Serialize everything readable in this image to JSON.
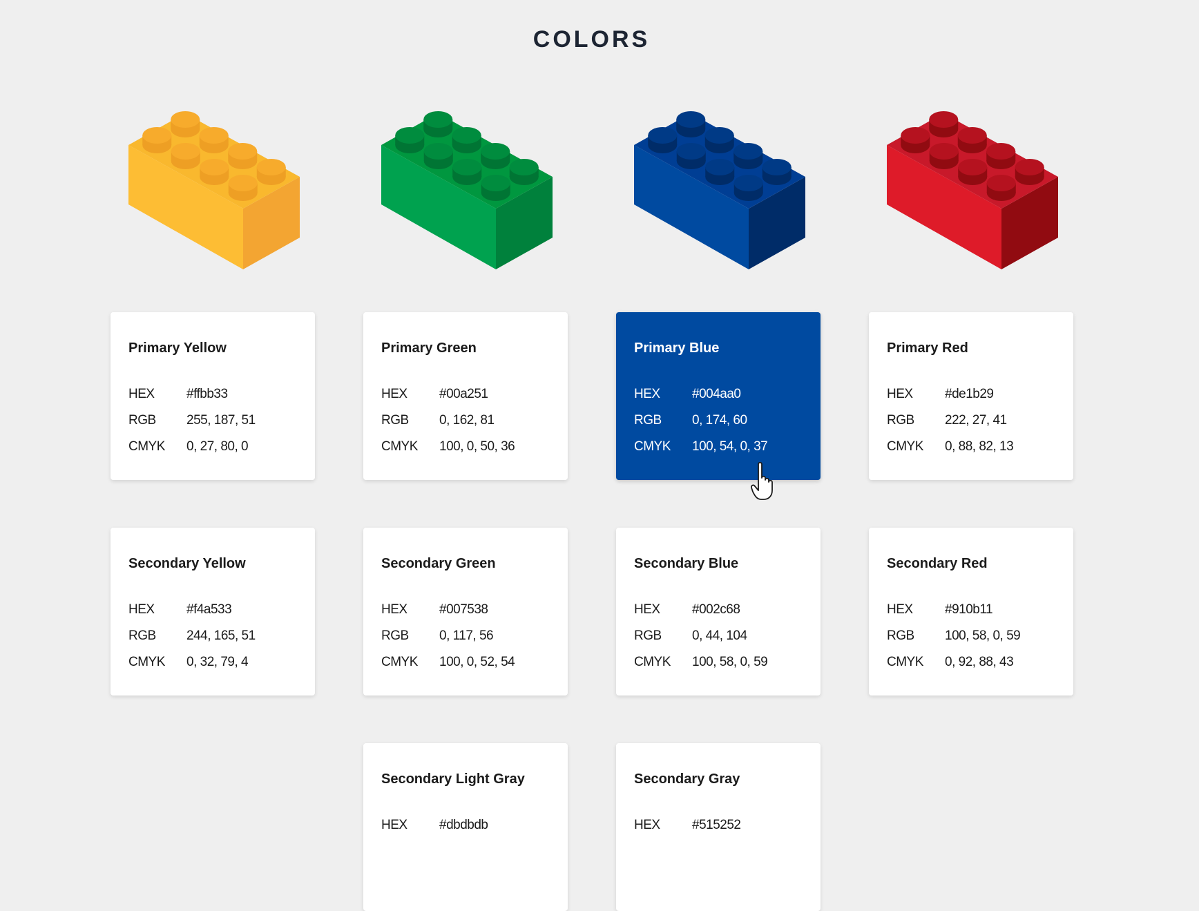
{
  "page": {
    "title": "COLORS"
  },
  "bricks": [
    {
      "name": "yellow-brick",
      "top": "#f9b82e",
      "left": "#fdbd34",
      "right": "#f3a532",
      "stud": "#f7ab2c",
      "stud_side": "#ee9f24"
    },
    {
      "name": "green-brick",
      "top": "#00973f",
      "left": "#00a24f",
      "right": "#00813c",
      "stud": "#008c3e",
      "stud_side": "#007534"
    },
    {
      "name": "blue-brick",
      "top": "#003e94",
      "left": "#004aa0",
      "right": "#002c68",
      "stud": "#003a86",
      "stud_side": "#002c68"
    },
    {
      "name": "red-brick",
      "top": "#c8192a",
      "left": "#de1b29",
      "right": "#910b11",
      "stud": "#b5121f",
      "stud_side": "#910b11"
    }
  ],
  "labels": {
    "hex": "HEX",
    "rgb": "RGB",
    "cmyk": "CMYK"
  },
  "cards": [
    {
      "name": "Primary Yellow",
      "hex": "#ffbb33",
      "rgb": "255, 187, 51",
      "cmyk": "0, 27, 80, 0"
    },
    {
      "name": "Primary Green",
      "hex": "#00a251",
      "rgb": "0, 162, 81",
      "cmyk": "100, 0, 50, 36"
    },
    {
      "name": "Primary Blue",
      "hex": "#004aa0",
      "rgb": "0, 174, 60",
      "cmyk": "100, 54, 0, 37",
      "active": true
    },
    {
      "name": "Primary Red",
      "hex": "#de1b29",
      "rgb": "222, 27, 41",
      "cmyk": "0, 88, 82, 13"
    },
    {
      "name": "Secondary Yellow",
      "hex": "#f4a533",
      "rgb": "244, 165, 51",
      "cmyk": "0, 32, 79, 4"
    },
    {
      "name": "Secondary Green",
      "hex": "#007538",
      "rgb": "0, 117, 56",
      "cmyk": "100, 0, 52, 54"
    },
    {
      "name": "Secondary Blue",
      "hex": "#002c68",
      "rgb": "0, 44, 104",
      "cmyk": "100, 58, 0, 59"
    },
    {
      "name": "Secondary Red",
      "hex": "#910b11",
      "rgb": "100, 58, 0, 59",
      "cmyk": "0, 92, 88, 43"
    },
    {
      "name": "Secondary Light Gray",
      "hex": "#dbdbdb"
    },
    {
      "name": "Secondary Gray",
      "hex": "#515252"
    }
  ]
}
